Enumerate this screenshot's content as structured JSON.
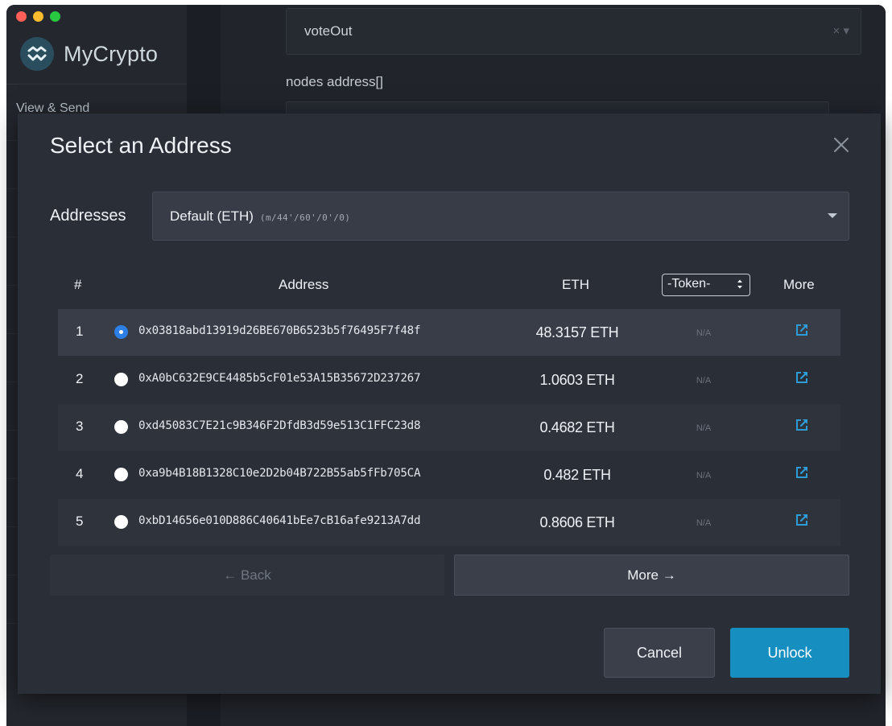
{
  "app": {
    "name": "MyCrypto",
    "sidebar_nav_label": "View & Send",
    "brand_color": "#2a4e5e"
  },
  "background_form": {
    "function_value": "voteOut",
    "field_label": "nodes address[]"
  },
  "modal": {
    "title": "Select an Address",
    "addresses_label": "Addresses",
    "dpath": {
      "name": "Default (ETH)",
      "path": "(m/44'/60'/0'/0)"
    },
    "table": {
      "headers": {
        "num": "#",
        "address": "Address",
        "eth": "ETH",
        "token_select": "-Token-",
        "more": "More"
      },
      "rows": [
        {
          "index": "1",
          "address": "0x03818abd13919d26BE670B6523b5f76495F7f48f",
          "eth": "48.3157 ETH",
          "token": "N/A",
          "selected": true
        },
        {
          "index": "2",
          "address": "0xA0bC632E9CE4485b5cF01e53A15B35672D237267",
          "eth": "1.0603 ETH",
          "token": "N/A",
          "selected": false
        },
        {
          "index": "3",
          "address": "0xd45083C7E21c9B346F2DfdB3d59e513C1FFC23d8",
          "eth": "0.4682 ETH",
          "token": "N/A",
          "selected": false
        },
        {
          "index": "4",
          "address": "0xa9b4B18B1328C10e2D2b04B722B55ab5fFb705CA",
          "eth": "0.482 ETH",
          "token": "N/A",
          "selected": false
        },
        {
          "index": "5",
          "address": "0xbD14656e010D886C40641bEe7cB16afe9213A7dd",
          "eth": "0.8606 ETH",
          "token": "N/A",
          "selected": false
        }
      ]
    },
    "pager": {
      "back_label": "← Back",
      "more_label": "More →"
    },
    "buttons": {
      "cancel": "Cancel",
      "unlock": "Unlock"
    },
    "colors": {
      "accent": "#168fc0",
      "radio_selected": "#2b7fe6",
      "link_icon": "#2e9cd6"
    }
  }
}
